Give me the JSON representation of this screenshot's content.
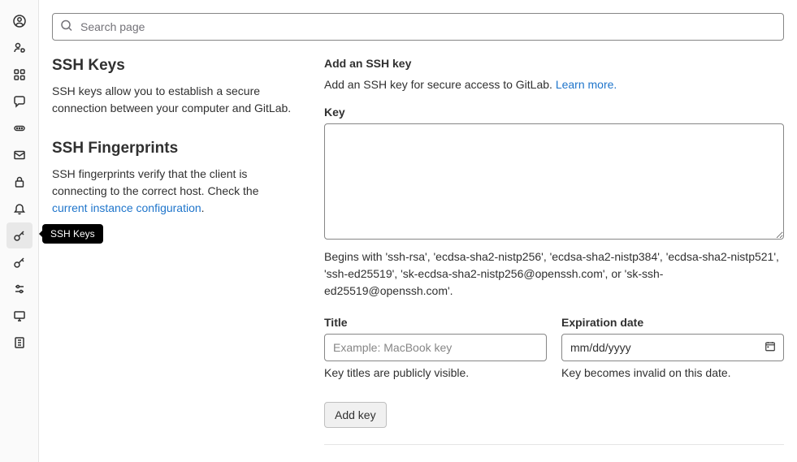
{
  "search": {
    "placeholder": "Search page"
  },
  "sidebar": {
    "tooltip": "SSH Keys"
  },
  "ssh_keys": {
    "heading": "SSH Keys",
    "desc": "SSH keys allow you to establish a secure connection between your computer and GitLab."
  },
  "fingerprints": {
    "heading": "SSH Fingerprints",
    "desc_pre": "SSH fingerprints verify that the client is connecting to the correct host. Check the ",
    "link": "current instance configuration",
    "desc_post": "."
  },
  "form": {
    "heading": "Add an SSH key",
    "sub_pre": "Add an SSH key for secure access to GitLab. ",
    "learn_more": "Learn more.",
    "key_label": "Key",
    "key_help": "Begins with 'ssh-rsa', 'ecdsa-sha2-nistp256', 'ecdsa-sha2-nistp384', 'ecdsa-sha2-nistp521', 'ssh-ed25519', 'sk-ecdsa-sha2-nistp256@openssh.com', or 'sk-ssh-ed25519@openssh.com'.",
    "title_label": "Title",
    "title_placeholder": "Example: MacBook key",
    "title_help": "Key titles are publicly visible.",
    "exp_label": "Expiration date",
    "exp_value": "mm/dd/yyyy",
    "exp_help": "Key becomes invalid on this date.",
    "submit": "Add key"
  }
}
